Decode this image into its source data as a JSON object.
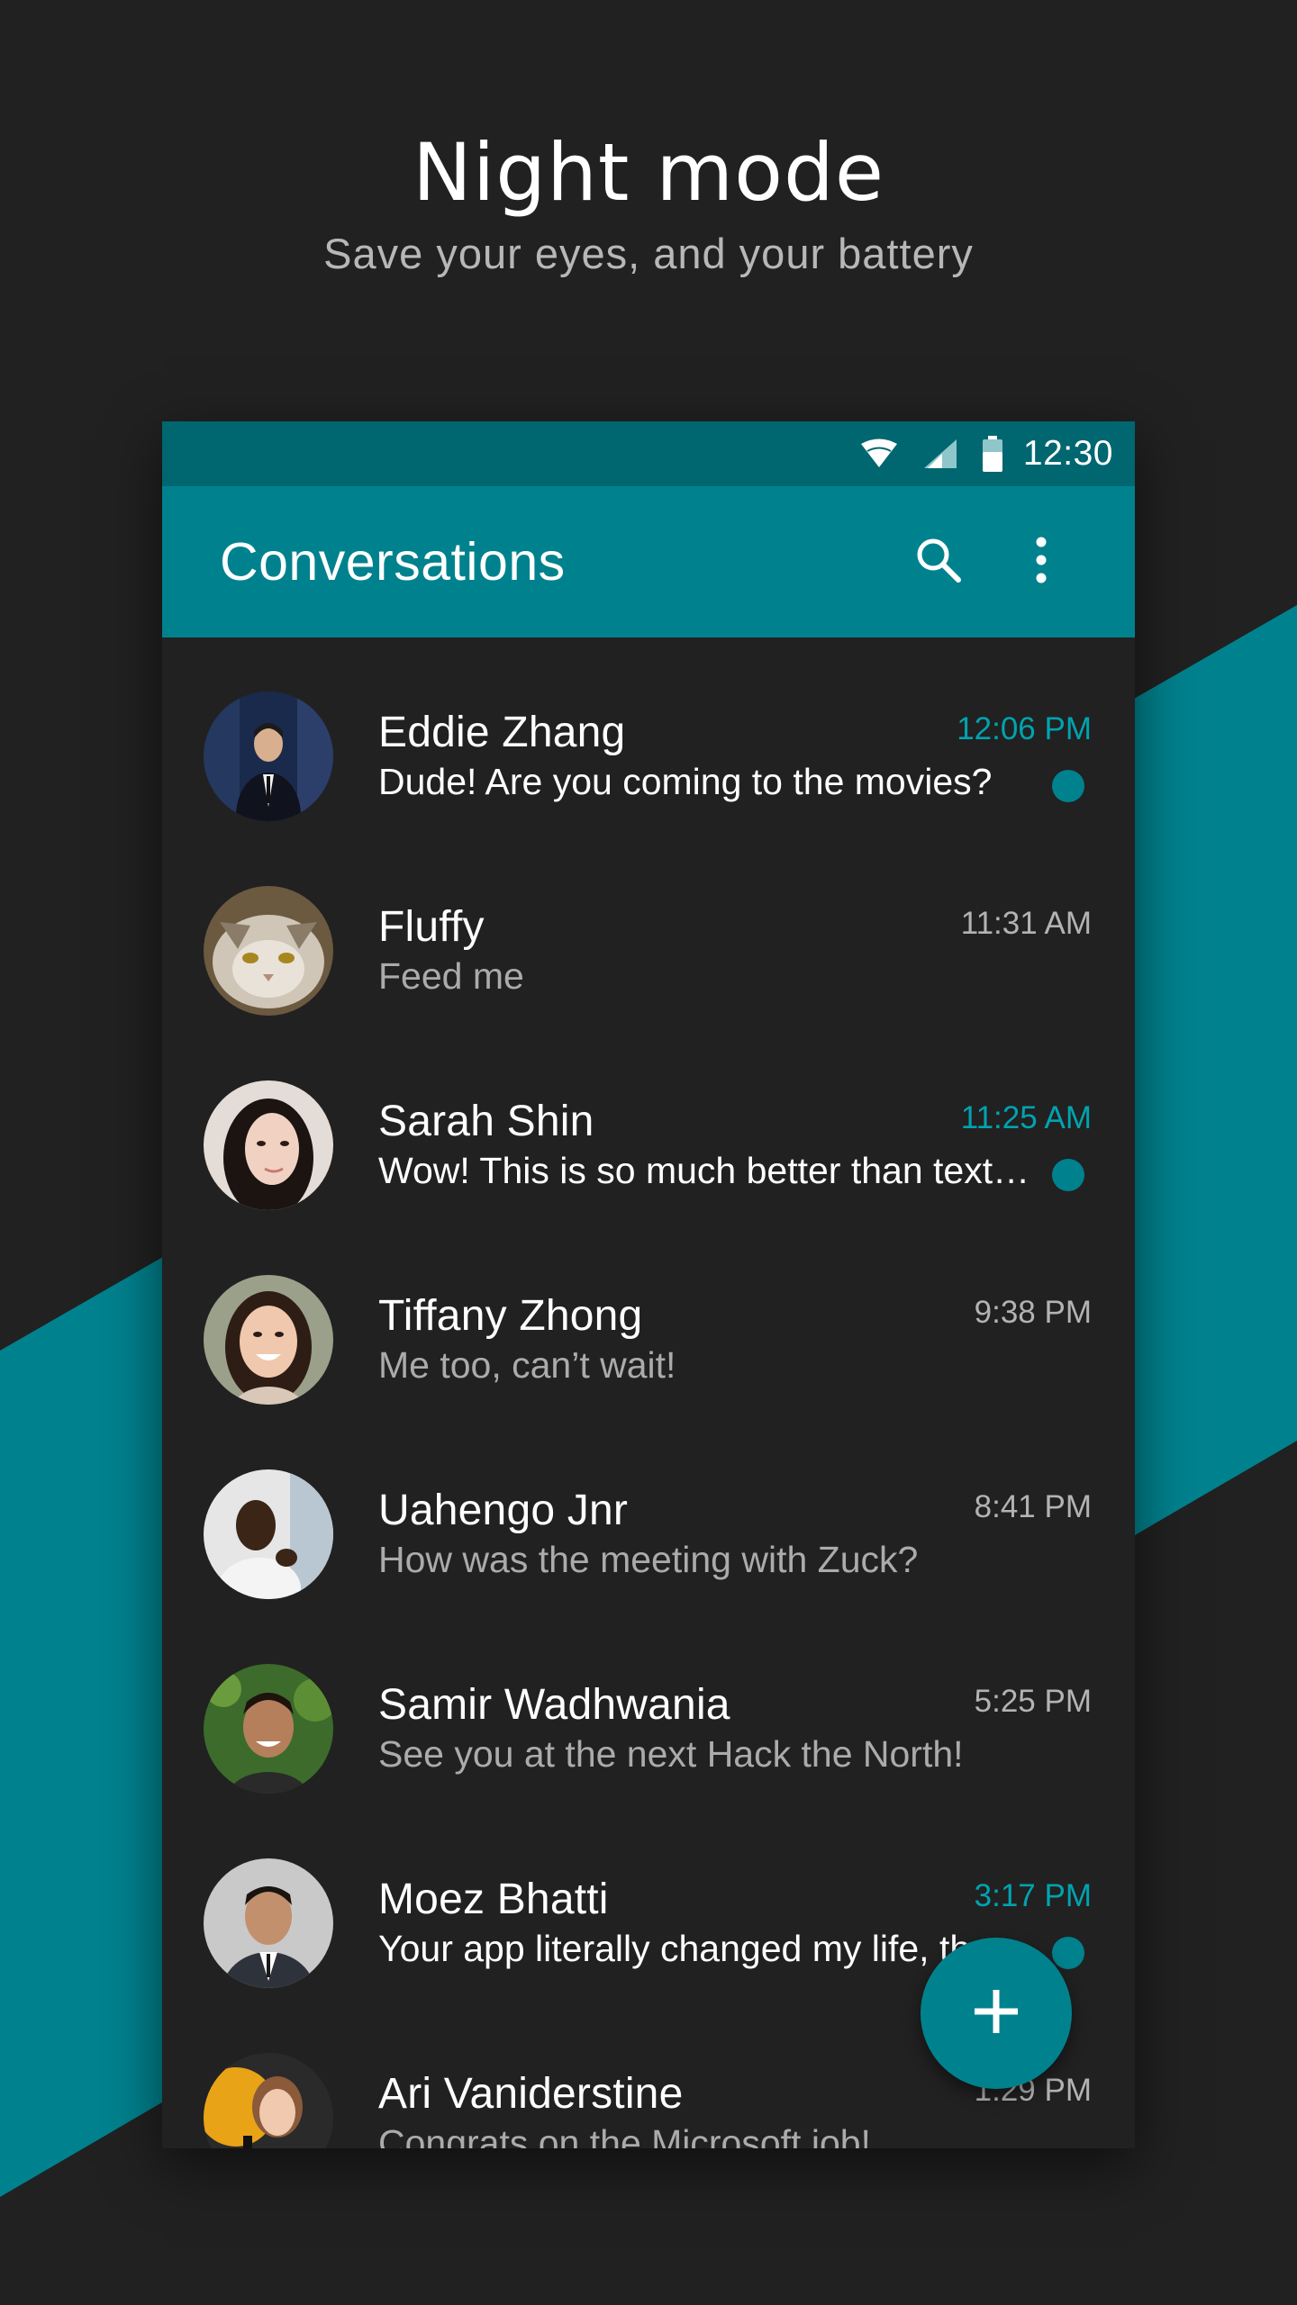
{
  "promo": {
    "title": "Night mode",
    "subtitle": "Save your eyes, and your battery"
  },
  "colors": {
    "background": "#212121",
    "accent": "#00828e",
    "status_bar": "#006670",
    "unread_accent": "#00a3b0"
  },
  "status_bar": {
    "icons": [
      "wifi-icon",
      "cell-signal-icon",
      "battery-icon"
    ],
    "time": "12:30"
  },
  "toolbar": {
    "title": "Conversations",
    "actions": [
      "search-icon",
      "more-vert-icon"
    ]
  },
  "conversations": [
    {
      "name": "Eddie Zhang",
      "snippet": "Dude! Are you coming to the movies?",
      "time": "12:06 PM",
      "unread": true
    },
    {
      "name": "Fluffy",
      "snippet": "Feed me",
      "time": "11:31 AM",
      "unread": false
    },
    {
      "name": "Sarah Shin",
      "snippet": "Wow! This is so much better than text…",
      "time": "11:25 AM",
      "unread": true
    },
    {
      "name": "Tiffany Zhong",
      "snippet": "Me too, can’t wait!",
      "time": "9:38 PM",
      "unread": false
    },
    {
      "name": "Uahengo Jnr",
      "snippet": "How was the meeting with Zuck?",
      "time": "8:41 PM",
      "unread": false
    },
    {
      "name": "Samir Wadhwania",
      "snippet": "See you at the next Hack the North!",
      "time": "5:25 PM",
      "unread": false
    },
    {
      "name": "Moez Bhatti",
      "snippet": "Your app literally changed my life, th",
      "time": "3:17 PM",
      "unread": true
    },
    {
      "name": "Ari Vaniderstine",
      "snippet": "Congrats on the Microsoft job!",
      "time": "1:29 PM",
      "unread": false
    }
  ],
  "fab": {
    "icon": "plus-icon"
  }
}
